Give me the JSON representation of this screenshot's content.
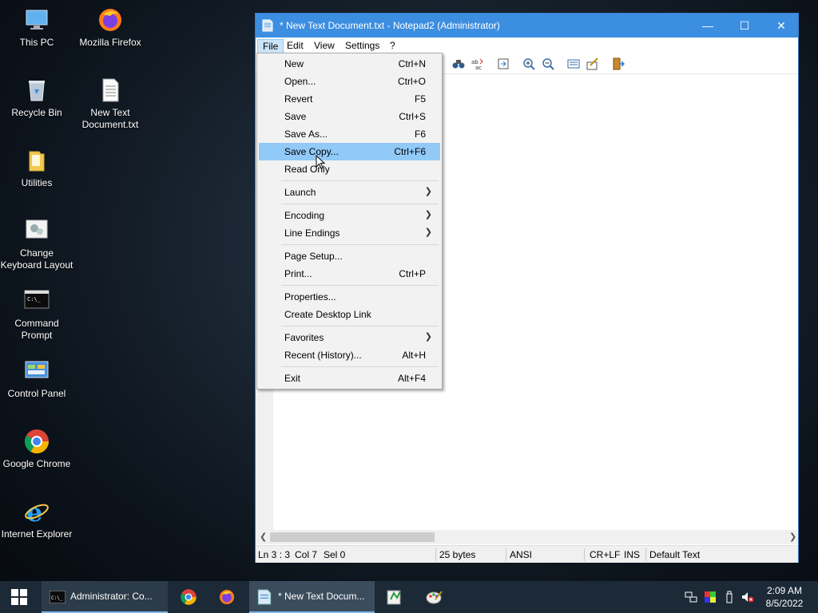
{
  "desktop": {
    "icons": [
      {
        "label": "This PC"
      },
      {
        "label": "Mozilla Firefox"
      },
      {
        "label": "Recycle Bin"
      },
      {
        "label": "New Text Document.txt"
      },
      {
        "label": "Utilities"
      },
      {
        "label": "Change Keyboard Layout"
      },
      {
        "label": "Command Prompt"
      },
      {
        "label": "Control Panel"
      },
      {
        "label": "Google Chrome"
      },
      {
        "label": "Internet Explorer"
      }
    ]
  },
  "window": {
    "title": "* New Text Document.txt - Notepad2 (Administrator)",
    "controls": {
      "minimize": "—",
      "maximize": "☐",
      "close": "✕"
    },
    "menu": [
      "File",
      "Edit",
      "View",
      "Settings",
      "?"
    ],
    "status": {
      "position": "Ln 3 : 3",
      "col": "Col 7",
      "sel": "Sel 0",
      "size": "25 bytes",
      "encoding": "ANSI",
      "line_endings": "CR+LF",
      "mode": "INS",
      "scheme": "Default Text"
    }
  },
  "file_menu": {
    "items": [
      {
        "label": "New",
        "shortcut": "Ctrl+N"
      },
      {
        "label": "Open...",
        "shortcut": "Ctrl+O"
      },
      {
        "label": "Revert",
        "shortcut": "F5"
      },
      {
        "label": "Save",
        "shortcut": "Ctrl+S"
      },
      {
        "label": "Save As...",
        "shortcut": "F6"
      },
      {
        "label": "Save Copy...",
        "shortcut": "Ctrl+F6"
      },
      {
        "label": "Read Only",
        "shortcut": ""
      },
      {
        "label": "Launch",
        "shortcut": ""
      },
      {
        "label": "Encoding",
        "shortcut": ""
      },
      {
        "label": "Line Endings",
        "shortcut": ""
      },
      {
        "label": "Page Setup...",
        "shortcut": ""
      },
      {
        "label": "Print...",
        "shortcut": "Ctrl+P"
      },
      {
        "label": "Properties...",
        "shortcut": ""
      },
      {
        "label": "Create Desktop Link",
        "shortcut": ""
      },
      {
        "label": "Favorites",
        "shortcut": ""
      },
      {
        "label": "Recent (History)...",
        "shortcut": "Alt+H"
      },
      {
        "label": "Exit",
        "shortcut": "Alt+F4"
      }
    ],
    "highlighted": "Save Copy..."
  },
  "taskbar": {
    "cmd_label": "Administrator: Co...",
    "notepad_label": "* New Text Docum...",
    "time": "2:09 AM",
    "date": "8/5/2022"
  },
  "colors": {
    "accent": "#3c8ee0",
    "menu_highlight": "#91c9f7",
    "taskbar": "#1c2a37"
  }
}
